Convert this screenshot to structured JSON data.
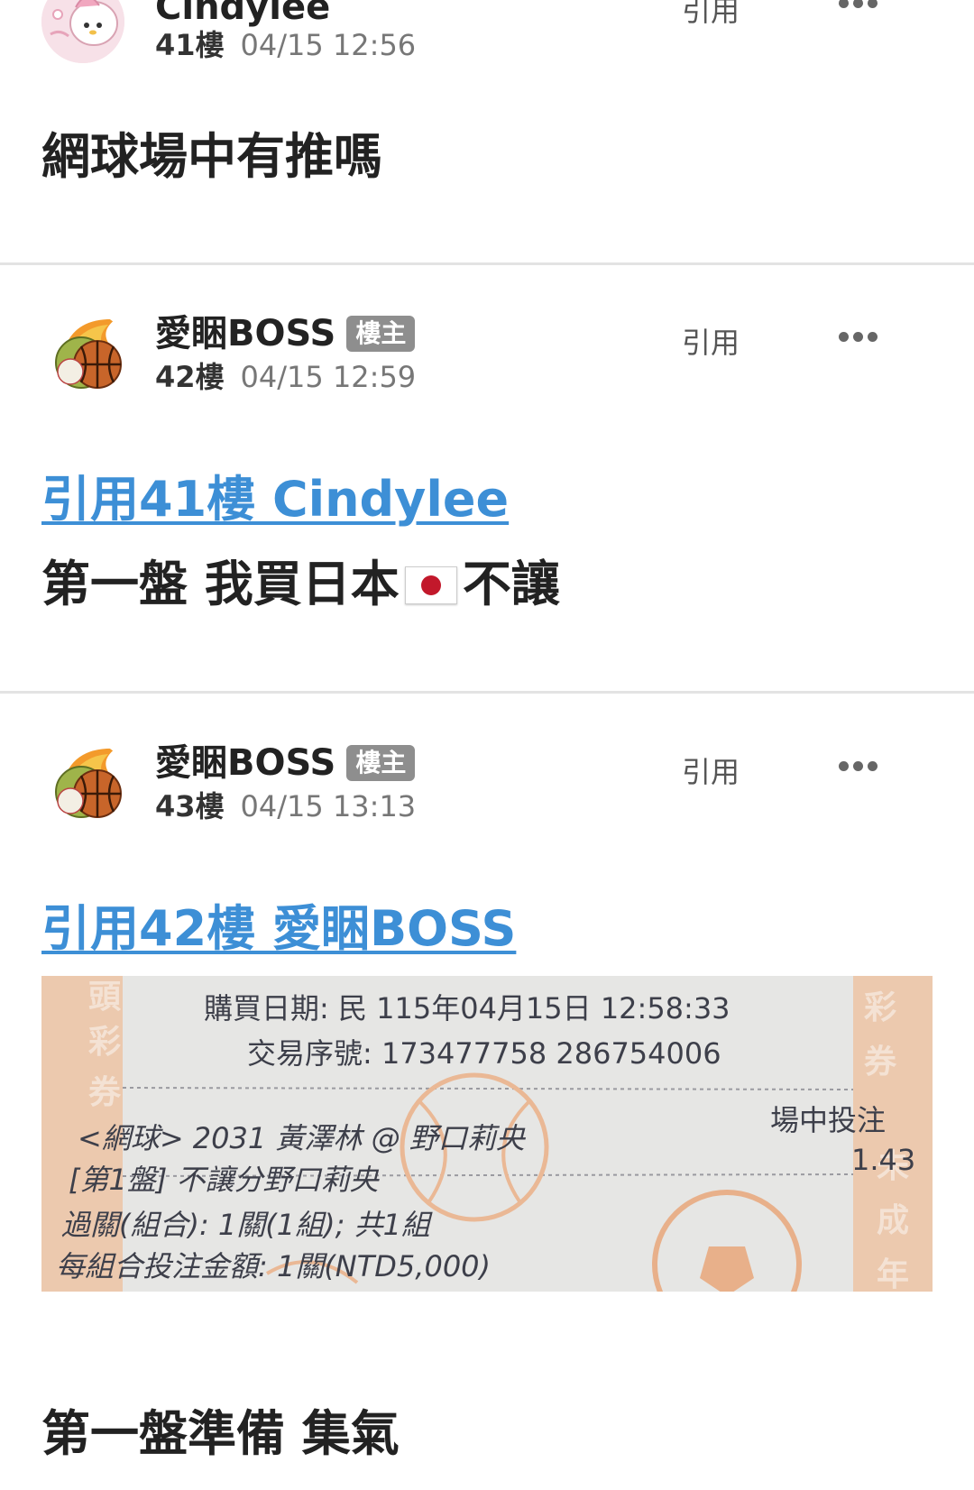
{
  "colors": {
    "link": "#3d8fd6",
    "badge_bg": "#8e8e8e",
    "divider": "#e3e3e3",
    "receipt_accent": "#e7b593"
  },
  "posts": [
    {
      "author": "Cindylee",
      "floor": "41樓",
      "time": "04/15 12:56",
      "quote_label": "引用",
      "avatar_icon": "my-melody-avatar",
      "content": "網球場中有推嗎"
    },
    {
      "author": "愛睏BOSS",
      "badge": "樓主",
      "floor": "42樓",
      "time": "04/15 12:59",
      "quote_label": "引用",
      "avatar_icon": "sports-balls-fire-avatar",
      "quote_ref": "引用41樓 Cindylee",
      "content_before_flag": "第一盤 我買日本",
      "flag_icon": "japan-flag-icon",
      "content_after_flag": "不讓"
    },
    {
      "author": "愛睏BOSS",
      "badge": "樓主",
      "floor": "43樓",
      "time": "04/15 13:13",
      "quote_label": "引用",
      "avatar_icon": "sports-balls-fire-avatar",
      "quote_ref": "引用42樓 愛睏BOSS",
      "content": "第一盤準備 集氣"
    }
  ],
  "receipt": {
    "purchase_date": "購買日期: 民  115年04月15日   12:58:33",
    "serial": "交易序號: 173477758 286754006",
    "in_play": "場中投注",
    "match": "<網球> 2031   黃澤林  @ 野口莉央",
    "bet": "[第1盤] 不讓分野口莉央",
    "odds": "1.43",
    "parlay": "過關(組合): 1關(1組); 共1組",
    "amount": "每組合投注金額: 1關(NTD5,000)",
    "side_left": [
      "頭",
      "彩",
      "券"
    ],
    "side_right": [
      "彩",
      "券",
      "未",
      "成",
      "年"
    ]
  }
}
